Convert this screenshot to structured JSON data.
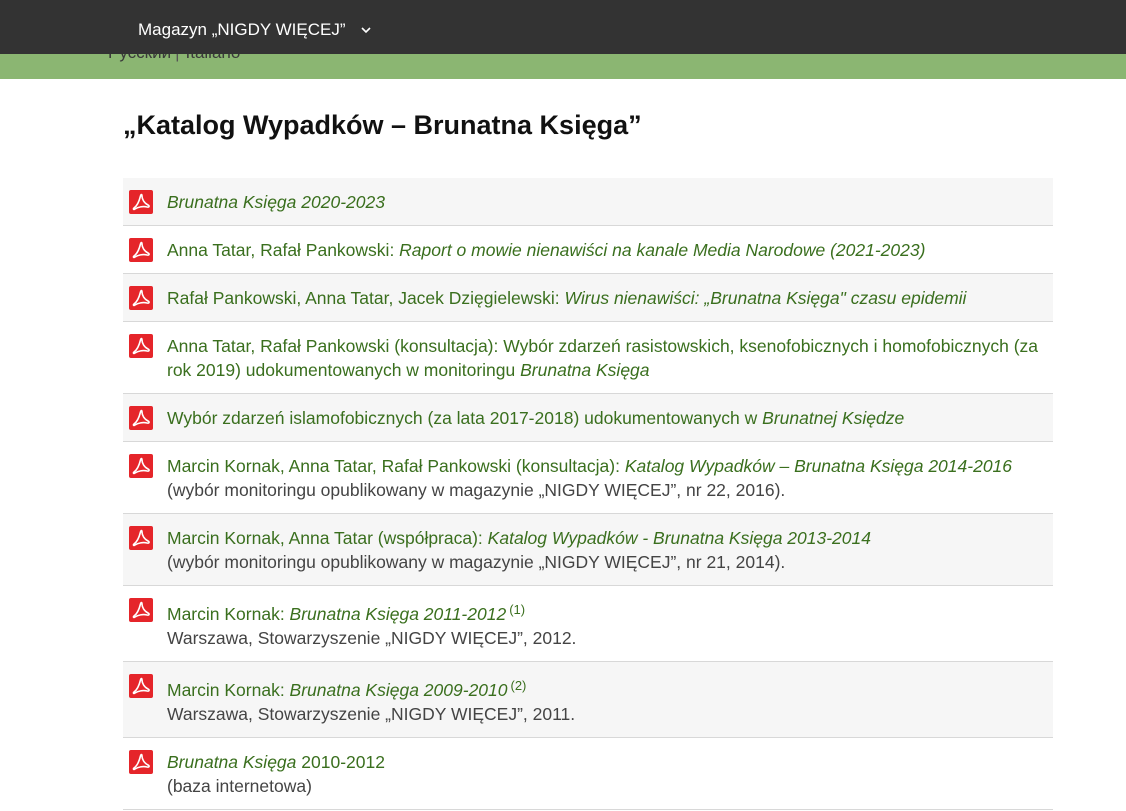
{
  "topbar": {
    "menu_label": "Magazyn „NIGDY WIĘCEJ”"
  },
  "languages": [
    "Русский",
    "Italiano"
  ],
  "page": {
    "title": "„Katalog Wypadków – Brunatna Księga”"
  },
  "items": [
    {
      "authors": "",
      "title": "Brunatna Księga 2020-2023",
      "after": "",
      "sup": "",
      "note": ""
    },
    {
      "authors": "Anna Tatar, Rafał Pankowski: ",
      "title": "Raport o mowie nienawiści na kanale Media Narodowe (2021-2023)",
      "after": "",
      "sup": "",
      "note": ""
    },
    {
      "authors": "Rafał Pankowski, Anna Tatar, Jacek Dzięgielewski: ",
      "title": "Wirus nienawiści: „Brunatna Księga\" czasu epidemii",
      "after": "",
      "sup": "",
      "note": ""
    },
    {
      "authors": "Anna Tatar, Rafał Pankowski (konsultacja): Wybór zdarzeń rasistowskich, ksenofobicznych i homofobicznych (za rok 2019) udokumentowanych w monitoringu ",
      "title": "Brunatna Księga",
      "after": "",
      "sup": "",
      "note": ""
    },
    {
      "authors": "Wybór zdarzeń islamofobicznych (za lata 2017-2018) udokumentowanych w ",
      "title": "Brunatnej Księdze",
      "after": "",
      "sup": "",
      "note": ""
    },
    {
      "authors": "Marcin Kornak, Anna Tatar, Rafał Pankowski (konsultacja): ",
      "title": "Katalog Wypadków – Brunatna Księga 2014-2016",
      "after": "",
      "sup": "",
      "note": "(wybór monitoringu opublikowany w magazynie „NIGDY WIĘCEJ”, nr 22, 2016)."
    },
    {
      "authors": "Marcin Kornak, Anna Tatar (współpraca): ",
      "title": "Katalog Wypadków - Brunatna Księga 2013-2014",
      "after": "",
      "sup": "",
      "note": "(wybór monitoringu opublikowany w magazynie „NIGDY WIĘCEJ”, nr 21, 2014)."
    },
    {
      "authors": "Marcin Kornak: ",
      "title": "Brunatna Księga 2011-2012",
      "after": "",
      "sup": "(1)",
      "note": "Warszawa, Stowarzyszenie „NIGDY WIĘCEJ”, 2012."
    },
    {
      "authors": "Marcin Kornak: ",
      "title": "Brunatna Księga 2009-2010",
      "after": "",
      "sup": "(2)",
      "note": "Warszawa, Stowarzyszenie „NIGDY WIĘCEJ”, 2011."
    },
    {
      "authors": "",
      "title": "Brunatna Księga",
      "after": " 2010-2012",
      "sup": "",
      "note": "(baza internetowa)"
    }
  ],
  "colors": {
    "topbar": "#333333",
    "accent_bar": "#8bb672",
    "link": "#3a6f1e",
    "pdf_red": "#e5252a"
  },
  "icons": {
    "pdf": "pdf-icon",
    "menu_chevron": "chevron-down-icon"
  }
}
